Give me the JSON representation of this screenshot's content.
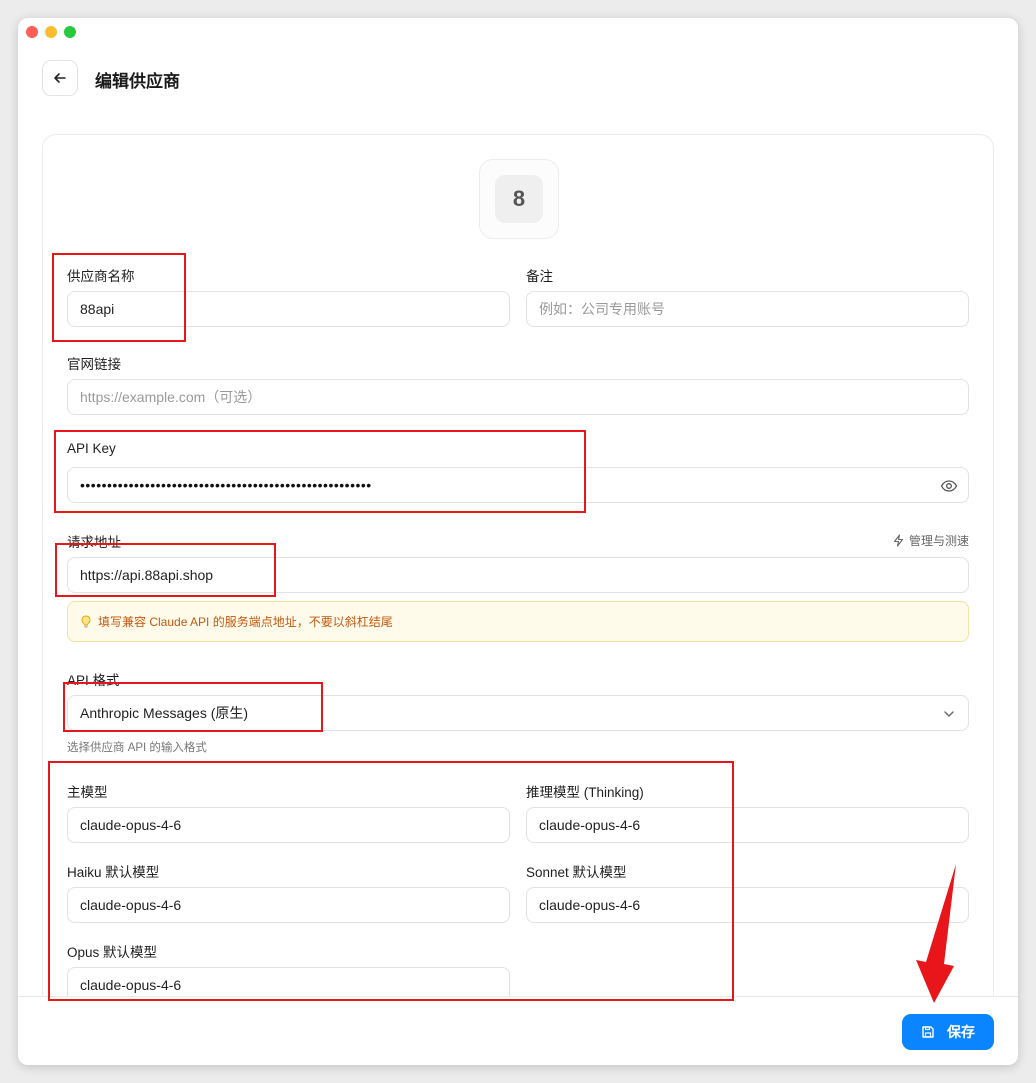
{
  "window": {
    "controls": [
      "close",
      "minimize",
      "zoom"
    ]
  },
  "header": {
    "back_icon": "arrow-left-icon",
    "title": "编辑供应商"
  },
  "provider": {
    "avatar_letter": "8"
  },
  "form": {
    "name": {
      "label": "供应商名称",
      "value": "88api"
    },
    "note": {
      "label": "备注",
      "placeholder": "例如：公司专用账号"
    },
    "website": {
      "label": "官网链接",
      "placeholder": "https://example.com（可选）"
    },
    "api_key": {
      "label": "API Key",
      "value_masked": "••••••••••••••••••••••••••••••••••••••••••••••••••••••",
      "toggle_icon": "eye-icon"
    },
    "endpoint": {
      "label": "请求地址",
      "value": "https://api.88api.shop",
      "manage_label": "管理与测速",
      "manage_icon": "lightning-icon",
      "hint_icon": "lightbulb-icon",
      "hint": "填写兼容 Claude API 的服务端点地址，不要以斜杠结尾"
    },
    "api_format": {
      "label": "API 格式",
      "value": "Anthropic Messages (原生)",
      "helper": "选择供应商 API 的输入格式",
      "dropdown_icon": "chevron-down-icon"
    },
    "models": {
      "main": {
        "label": "主模型",
        "value": "claude-opus-4-6"
      },
      "thinking": {
        "label": "推理模型 (Thinking)",
        "value": "claude-opus-4-6"
      },
      "haiku": {
        "label": "Haiku 默认模型",
        "value": "claude-opus-4-6"
      },
      "sonnet": {
        "label": "Sonnet 默认模型",
        "value": "claude-opus-4-6"
      },
      "opus": {
        "label": "Opus 默认模型",
        "value": "claude-opus-4-6"
      }
    }
  },
  "footer": {
    "save_label": "保存",
    "save_icon": "save-icon"
  },
  "colors": {
    "accent": "#0a84ff",
    "annotation": "#e8161b",
    "hint_bg": "#fffbea",
    "hint_text": "#c25a12"
  }
}
